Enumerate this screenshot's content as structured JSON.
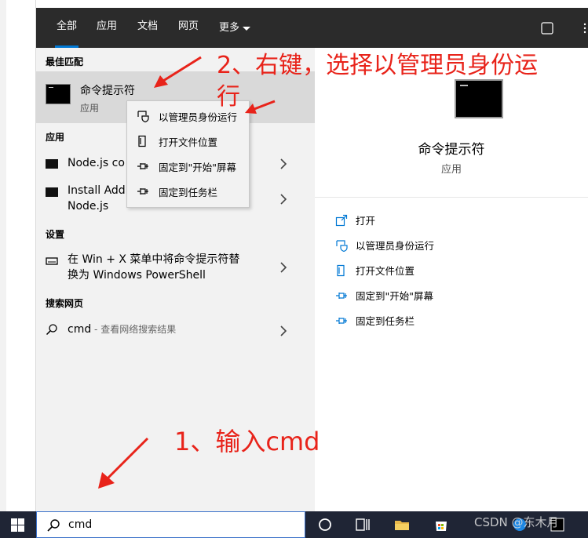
{
  "tabs": [
    {
      "label": "全部"
    },
    {
      "label": "应用"
    },
    {
      "label": "文档"
    },
    {
      "label": "网页"
    },
    {
      "label": "更多"
    }
  ],
  "best_match": {
    "header": "最佳匹配",
    "title": "命令提示符",
    "subtitle": "应用"
  },
  "apps": {
    "header": "应用",
    "items": [
      {
        "label": "Node.js co"
      },
      {
        "label_line1": "Install Add",
        "label_line2": "Node.js"
      }
    ]
  },
  "settings": {
    "header": "设置",
    "item_line1": "在 Win + X 菜单中将命令提示符替",
    "item_line2": "换为 Windows PowerShell"
  },
  "web": {
    "header": "搜索网页",
    "query": "cmd",
    "hint": " - 查看网络搜索结果"
  },
  "context_menu": [
    {
      "label": "以管理员身份运行",
      "icon": "shield-icon"
    },
    {
      "label": "打开文件位置",
      "icon": "file-location-icon"
    },
    {
      "label": "固定到\"开始\"屏幕",
      "icon": "pin-icon"
    },
    {
      "label": "固定到任务栏",
      "icon": "pin-icon"
    }
  ],
  "preview": {
    "title": "命令提示符",
    "subtitle": "应用",
    "actions": [
      {
        "label": "打开",
        "icon": "open-icon"
      },
      {
        "label": "以管理员身份运行",
        "icon": "shield-icon"
      },
      {
        "label": "打开文件位置",
        "icon": "file-location-icon"
      },
      {
        "label": "固定到\"开始\"屏幕",
        "icon": "pin-icon"
      },
      {
        "label": "固定到任务栏",
        "icon": "pin-icon"
      }
    ]
  },
  "annotations": {
    "step2_line1": "2、右键，选择以管理员身份运",
    "step2_line2": "行",
    "step1": "1、输入cmd"
  },
  "taskbar": {
    "search_value": "cmd",
    "watermark": "CSDN @东木月"
  },
  "colors": {
    "accent": "#0078d4",
    "annotation": "#e8231a",
    "topbar": "#2b2b2b",
    "taskbar": "#1f2535"
  }
}
